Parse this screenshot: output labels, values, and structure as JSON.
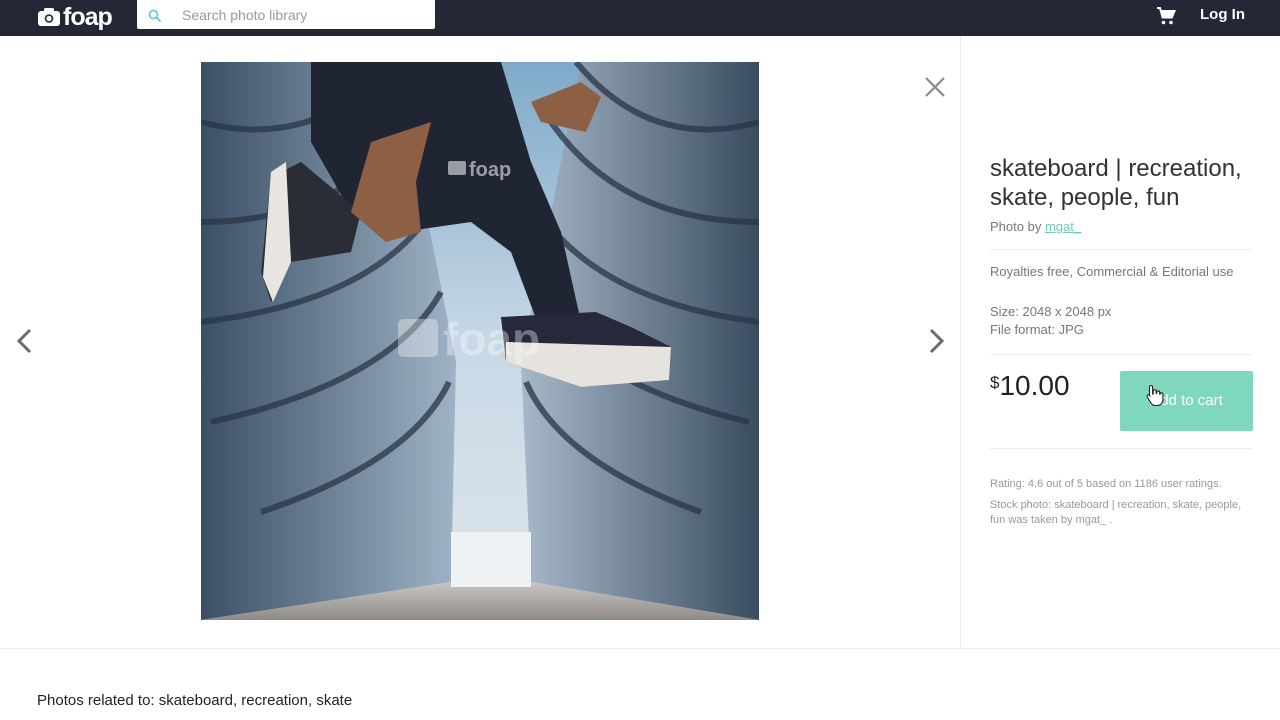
{
  "header": {
    "logo_text": "foap",
    "search_placeholder": "Search photo library",
    "login_label": "Log In"
  },
  "icons": {
    "logo": "camera-icon",
    "search": "search-icon",
    "cart": "cart-icon",
    "prev": "chevron-left-icon",
    "next": "chevron-right-icon",
    "close": "close-icon",
    "cursor": "hand-pointer-icon"
  },
  "photo": {
    "watermark_text": "foap"
  },
  "details": {
    "title": "skateboard | recreation, skate, people, fun",
    "photo_by_label": "Photo by",
    "author": "mgat_",
    "license": "Royalties free, Commercial & Editorial use",
    "size": "Size: 2048 x 2048 px",
    "format": "File format: JPG",
    "currency": "$",
    "price": "10.00",
    "add_to_cart": "Add to cart",
    "rating_text": "Rating: 4.6  out of 5  based on 1186 user ratings.",
    "stock_text": "Stock photo: skateboard | recreation, skate, people, fun was taken by mgat_ ."
  },
  "related": {
    "heading": "Photos related to: skateboard, recreation, skate"
  },
  "colors": {
    "header_bg": "#242735",
    "accent": "#7fd7bd",
    "link": "#6ecbb6"
  }
}
